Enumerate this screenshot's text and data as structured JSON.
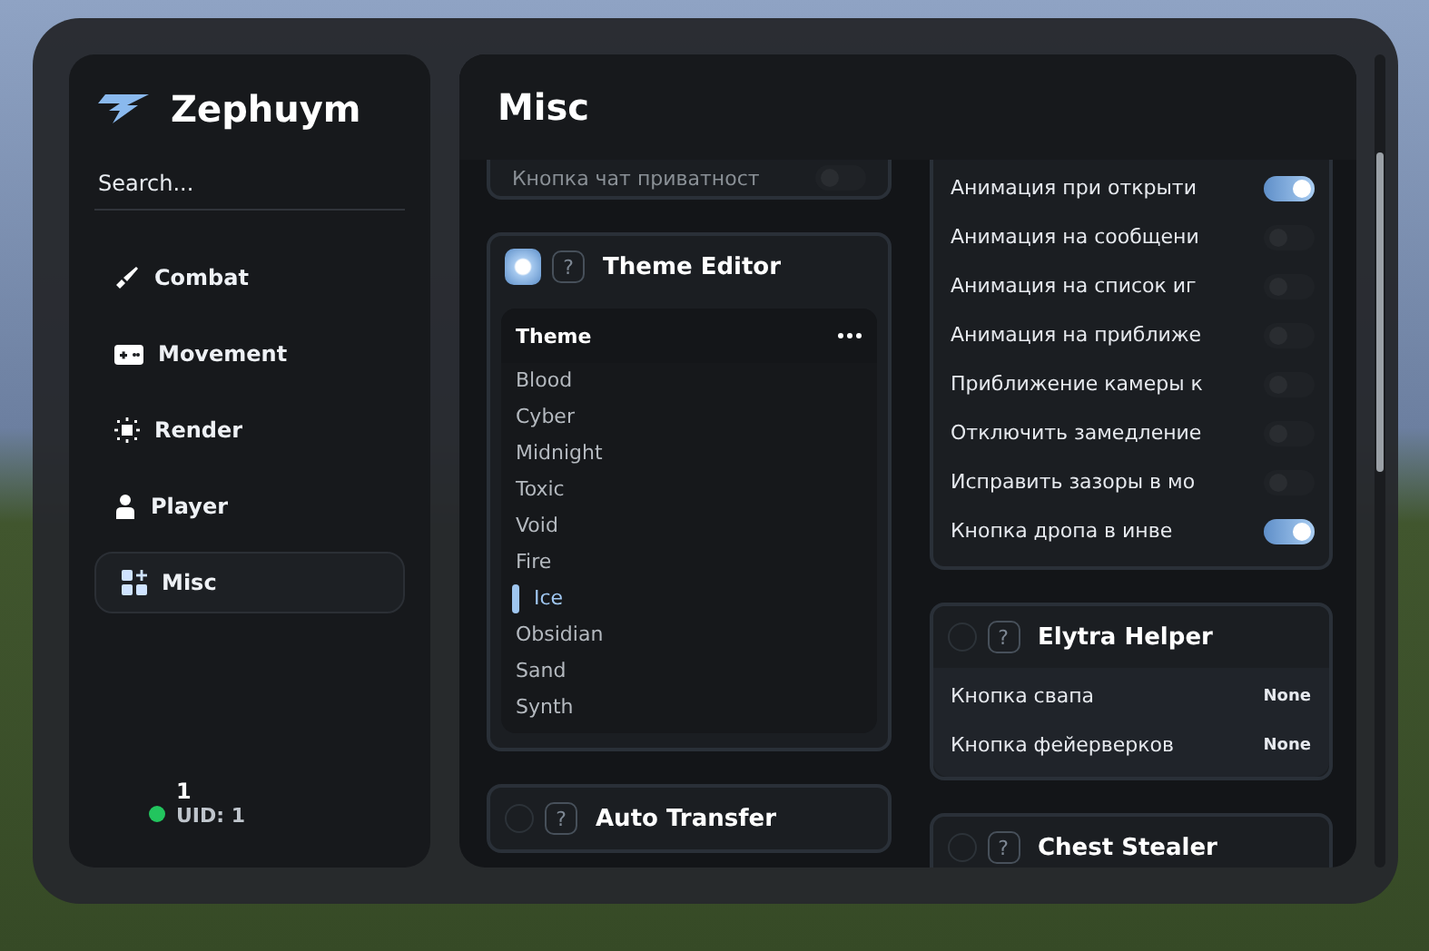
{
  "brand": {
    "name": "Zephuym"
  },
  "search": {
    "placeholder": "Search..."
  },
  "categories": [
    {
      "label": "Combat",
      "kind": "sword",
      "selected": false
    },
    {
      "label": "Movement",
      "kind": "gamepad",
      "selected": false
    },
    {
      "label": "Render",
      "kind": "render",
      "selected": false
    },
    {
      "label": "Player",
      "kind": "player",
      "selected": false
    },
    {
      "label": "Misc",
      "kind": "grid",
      "selected": true
    }
  ],
  "user": {
    "name": "1",
    "uid": "UID: 1",
    "online": true
  },
  "panel": {
    "title": "Misc"
  },
  "left_column": [
    {
      "kind": "partial",
      "label": "Кнопка чат приватност",
      "on": false
    },
    {
      "kind": "module",
      "title": "Theme Editor",
      "help": "?",
      "enabled": true,
      "list": {
        "title": "Theme",
        "options": [
          {
            "label": "Blood",
            "selected": false
          },
          {
            "label": "Cyber",
            "selected": false
          },
          {
            "label": "Midnight",
            "selected": false
          },
          {
            "label": "Toxic",
            "selected": false
          },
          {
            "label": "Void",
            "selected": false
          },
          {
            "label": "Fire",
            "selected": false
          },
          {
            "label": "Ice",
            "selected": true
          },
          {
            "label": "Obsidian",
            "selected": false
          },
          {
            "label": "Sand",
            "selected": false
          },
          {
            "label": "Synth",
            "selected": false
          }
        ]
      }
    },
    {
      "kind": "module",
      "title": "Auto Transfer",
      "help": "?",
      "enabled": false
    }
  ],
  "right_column": [
    {
      "kind": "settings",
      "settings": [
        {
          "label": "Анимация при открыти",
          "on": true
        },
        {
          "label": "Анимация на сообщени",
          "on": false
        },
        {
          "label": "Анимация на список иг",
          "on": false
        },
        {
          "label": "Анимация на приближе",
          "on": false
        },
        {
          "label": "Приближение камеры к",
          "on": false
        },
        {
          "label": "Отключить замедление",
          "on": false
        },
        {
          "label": "Исправить зазоры в мо",
          "on": false
        },
        {
          "label": "Кнопка дропа в инве",
          "on": true
        }
      ]
    },
    {
      "kind": "module",
      "title": "Elytra Helper",
      "help": "?",
      "enabled": false,
      "binds": [
        {
          "label": "Кнопка свапа",
          "value": "None"
        },
        {
          "label": "Кнопка фейерверков",
          "value": "None"
        }
      ]
    },
    {
      "kind": "module",
      "title": "Chest Stealer",
      "help": "?",
      "enabled": false
    }
  ]
}
